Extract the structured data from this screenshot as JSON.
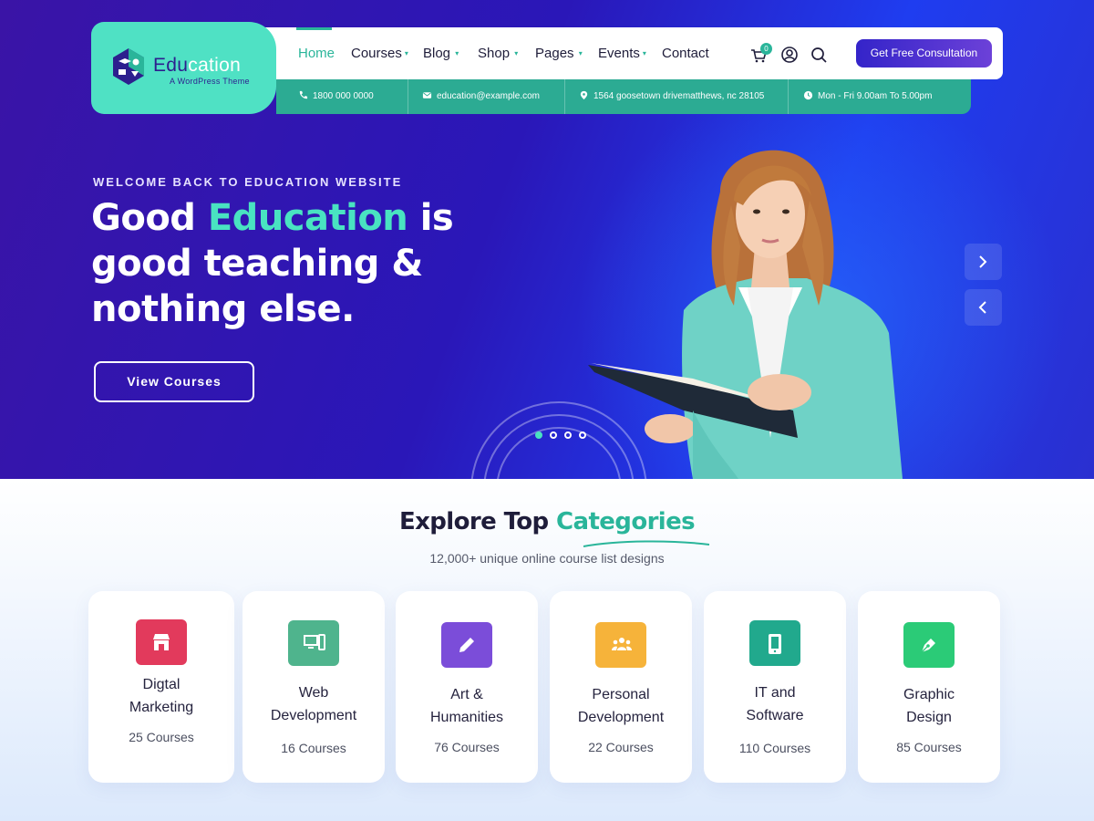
{
  "brand": {
    "name_part1": "Edu",
    "name_part2": "cation",
    "tagline": "A WordPress Theme"
  },
  "nav": {
    "items": [
      {
        "label": "Home",
        "active": true,
        "has_dropdown": false
      },
      {
        "label": "Courses",
        "active": false,
        "has_dropdown": true
      },
      {
        "label": "Blog",
        "active": false,
        "has_dropdown": true
      },
      {
        "label": "Shop",
        "active": false,
        "has_dropdown": true
      },
      {
        "label": "Pages",
        "active": false,
        "has_dropdown": true
      },
      {
        "label": "Events",
        "active": false,
        "has_dropdown": true
      },
      {
        "label": "Contact",
        "active": false,
        "has_dropdown": false
      }
    ],
    "cart_count": "0",
    "icons": [
      "cart-icon",
      "user-icon",
      "search-icon"
    ],
    "cta_label": "Get Free Consultation"
  },
  "info_bar": {
    "phone": "1800 000 0000",
    "email": "education@example.com",
    "address": "1564 goosetown drivematthews, nc 28105",
    "hours": "Mon - Fri  9.00am To 5.00pm"
  },
  "hero": {
    "kicker": "WELCOME BACK TO EDUCATION WEBSITE",
    "headline_part1": "Good ",
    "headline_highlight": "Education",
    "headline_part2": " is good teaching & nothing else.",
    "button_label": "View Courses",
    "slides_total": 4,
    "active_slide": 1
  },
  "categories": {
    "title_part1": "Explore Top ",
    "title_highlight": "Categories",
    "subtitle": "12,000+ unique online course list designs",
    "items": [
      {
        "name": "Digtal Marketing",
        "count": "25 Courses",
        "color": "#e23a5c",
        "icon": "store-icon"
      },
      {
        "name": "Web Development",
        "count": "16 Courses",
        "color": "#4fb48d",
        "icon": "computer-icon"
      },
      {
        "name": "Art & Humanities",
        "count": "76 Courses",
        "color": "#7b4dd9",
        "icon": "pencil-icon"
      },
      {
        "name": "Personal Development",
        "count": "22 Courses",
        "color": "#f6b33a",
        "icon": "people-icon"
      },
      {
        "name": "IT and Software",
        "count": "110 Courses",
        "color": "#21a98d",
        "icon": "tablet-icon"
      },
      {
        "name": "Graphic Design",
        "count": "85 Courses",
        "color": "#2bcb77",
        "icon": "pen-nib-icon"
      }
    ]
  },
  "colors": {
    "accent": "#2ab59a",
    "logo_bg": "#4fe1c4",
    "hero_bg": "#2a17b8",
    "cta_bg": "#3424c9"
  }
}
